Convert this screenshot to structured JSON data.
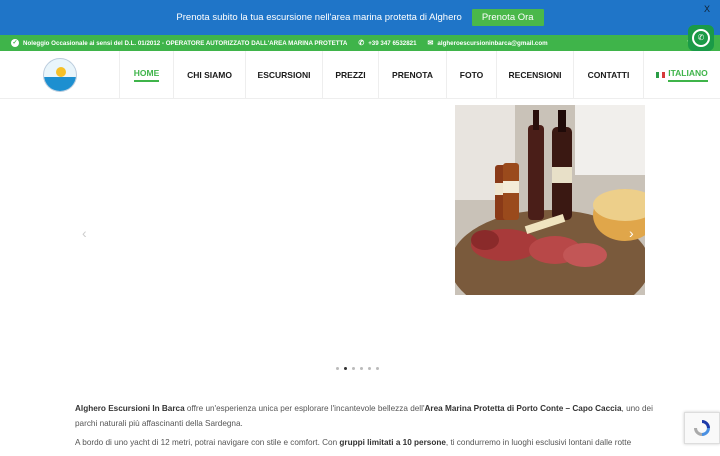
{
  "promo": {
    "text": "Prenota subito la tua escursione nell'area marina protetta di Alghero",
    "button": "Prenota Ora",
    "close": "X"
  },
  "topbar": {
    "notice": "Noleggio Occasionale ai sensi del D.L. 01/2012 - OPERATORE AUTORIZZATO DALL'AREA MARINA PROTETTA",
    "phone": "+39 347 6532821",
    "email": "algheroescursioninbarca@gmail.com",
    "social": "f"
  },
  "nav": {
    "items": [
      {
        "label": "HOME",
        "active": true
      },
      {
        "label": "CHI SIAMO"
      },
      {
        "label": "ESCURSIONI"
      },
      {
        "label": "PREZZI"
      },
      {
        "label": "PRENOTA"
      },
      {
        "label": "FOTO"
      },
      {
        "label": "RECENSIONI"
      },
      {
        "label": "CONTATTI"
      },
      {
        "label": "ITALIANO"
      }
    ]
  },
  "slider": {
    "prev": "‹",
    "next": "›",
    "dots": 6,
    "active_dot": 2
  },
  "content": {
    "p1_brand": "Alghero Escursioni In Barca",
    "p1_text1": " offre un'esperienza unica per esplorare l'incantevole bellezza dell'",
    "p1_area": "Area Marina Protetta di Porto Conte – Capo Caccia",
    "p1_text2": ", uno dei parchi naturali più affascinanti della Sardegna.",
    "p2_text1": "A bordo di uno yacht di 12 metri, potrai navigare con stile e comfort. Con ",
    "p2_groups": "gruppi limitati a 10 persone",
    "p2_text2": ", ti condurremo in luoghi esclusivi lontani dalle rotte"
  },
  "colors": {
    "promo_bg": "#1f75c8",
    "green": "#3fb44a",
    "whatsapp": "#1a9a47"
  }
}
